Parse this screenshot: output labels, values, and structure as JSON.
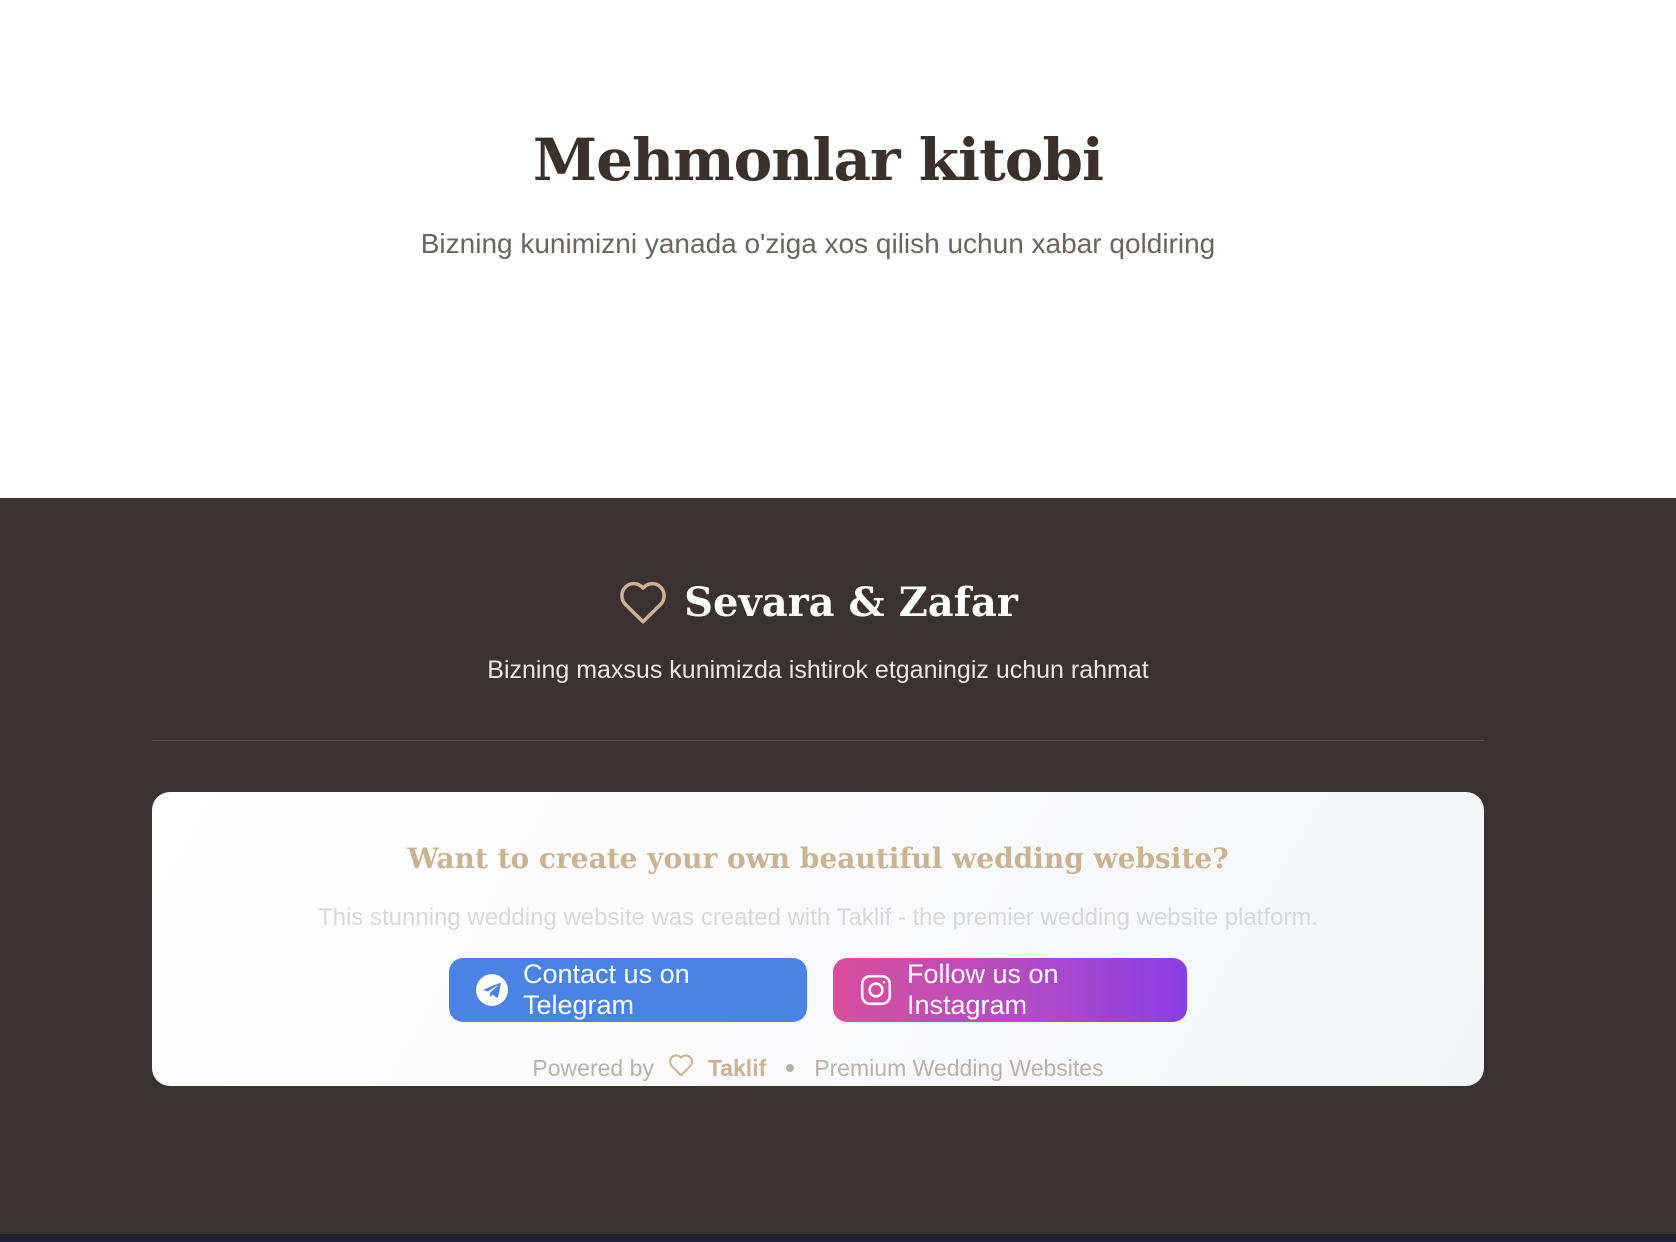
{
  "guestbook": {
    "title": "Mehmonlar kitobi",
    "subtitle": "Bizning kunimizni yanada o'ziga xos qilish uchun xabar qoldiring"
  },
  "footer": {
    "heart_icon": "heart-outline-icon",
    "couple_name": "Sevara & Zafar",
    "thanks": "Bizning maxsus kunimizda ishtirok etganingiz uchun rahmat",
    "promo": {
      "title": "Want to create your own beautiful wedding website?",
      "text": "This stunning wedding website was created with Taklif - the premier wedding website platform.",
      "telegram_button": {
        "label": "Contact us on Telegram",
        "icon": "telegram-icon",
        "color": "#4a82e6"
      },
      "instagram_button": {
        "label": "Follow us on Instagram",
        "icon": "instagram-icon",
        "gradient": [
          "#d84f9c",
          "#8a3ee6"
        ]
      }
    },
    "powered": {
      "prefix": "Powered by",
      "brand": "Taklif",
      "tagline": "Premium Wedding Websites"
    }
  },
  "colors": {
    "accent_gold": "#cbb391",
    "footer_bg": "#3a3230",
    "heading_dark": "#3a312c"
  }
}
